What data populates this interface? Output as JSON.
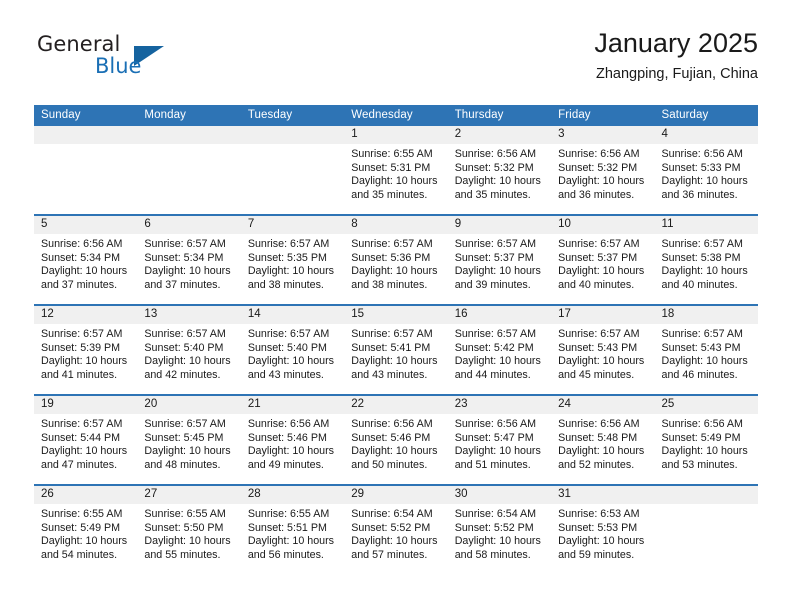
{
  "brand": {
    "name_part1": "General",
    "name_part2": "Blue",
    "triangle_color": "#15639f",
    "blue_text_color": "#1a6fb5"
  },
  "header": {
    "title": "January 2025",
    "subtitle": "Zhangping, Fujian, China"
  },
  "theme": {
    "header_blue": "#2e74b5",
    "daynum_band": "#f0f0f0",
    "text": "#1a1a1a"
  },
  "weekday_headers": [
    "Sunday",
    "Monday",
    "Tuesday",
    "Wednesday",
    "Thursday",
    "Friday",
    "Saturday"
  ],
  "labels": {
    "sunrise_prefix": "Sunrise:",
    "sunset_prefix": "Sunset:",
    "daylight_prefix": "Daylight:"
  },
  "weeks": [
    [
      {
        "day": "",
        "sunrise": "",
        "sunset": "",
        "daylight_line1": "",
        "daylight_line2": ""
      },
      {
        "day": "",
        "sunrise": "",
        "sunset": "",
        "daylight_line1": "",
        "daylight_line2": ""
      },
      {
        "day": "",
        "sunrise": "",
        "sunset": "",
        "daylight_line1": "",
        "daylight_line2": ""
      },
      {
        "day": "1",
        "sunrise": "Sunrise: 6:55 AM",
        "sunset": "Sunset: 5:31 PM",
        "daylight_line1": "Daylight: 10 hours",
        "daylight_line2": "and 35 minutes."
      },
      {
        "day": "2",
        "sunrise": "Sunrise: 6:56 AM",
        "sunset": "Sunset: 5:32 PM",
        "daylight_line1": "Daylight: 10 hours",
        "daylight_line2": "and 35 minutes."
      },
      {
        "day": "3",
        "sunrise": "Sunrise: 6:56 AM",
        "sunset": "Sunset: 5:32 PM",
        "daylight_line1": "Daylight: 10 hours",
        "daylight_line2": "and 36 minutes."
      },
      {
        "day": "4",
        "sunrise": "Sunrise: 6:56 AM",
        "sunset": "Sunset: 5:33 PM",
        "daylight_line1": "Daylight: 10 hours",
        "daylight_line2": "and 36 minutes."
      }
    ],
    [
      {
        "day": "5",
        "sunrise": "Sunrise: 6:56 AM",
        "sunset": "Sunset: 5:34 PM",
        "daylight_line1": "Daylight: 10 hours",
        "daylight_line2": "and 37 minutes."
      },
      {
        "day": "6",
        "sunrise": "Sunrise: 6:57 AM",
        "sunset": "Sunset: 5:34 PM",
        "daylight_line1": "Daylight: 10 hours",
        "daylight_line2": "and 37 minutes."
      },
      {
        "day": "7",
        "sunrise": "Sunrise: 6:57 AM",
        "sunset": "Sunset: 5:35 PM",
        "daylight_line1": "Daylight: 10 hours",
        "daylight_line2": "and 38 minutes."
      },
      {
        "day": "8",
        "sunrise": "Sunrise: 6:57 AM",
        "sunset": "Sunset: 5:36 PM",
        "daylight_line1": "Daylight: 10 hours",
        "daylight_line2": "and 38 minutes."
      },
      {
        "day": "9",
        "sunrise": "Sunrise: 6:57 AM",
        "sunset": "Sunset: 5:37 PM",
        "daylight_line1": "Daylight: 10 hours",
        "daylight_line2": "and 39 minutes."
      },
      {
        "day": "10",
        "sunrise": "Sunrise: 6:57 AM",
        "sunset": "Sunset: 5:37 PM",
        "daylight_line1": "Daylight: 10 hours",
        "daylight_line2": "and 40 minutes."
      },
      {
        "day": "11",
        "sunrise": "Sunrise: 6:57 AM",
        "sunset": "Sunset: 5:38 PM",
        "daylight_line1": "Daylight: 10 hours",
        "daylight_line2": "and 40 minutes."
      }
    ],
    [
      {
        "day": "12",
        "sunrise": "Sunrise: 6:57 AM",
        "sunset": "Sunset: 5:39 PM",
        "daylight_line1": "Daylight: 10 hours",
        "daylight_line2": "and 41 minutes."
      },
      {
        "day": "13",
        "sunrise": "Sunrise: 6:57 AM",
        "sunset": "Sunset: 5:40 PM",
        "daylight_line1": "Daylight: 10 hours",
        "daylight_line2": "and 42 minutes."
      },
      {
        "day": "14",
        "sunrise": "Sunrise: 6:57 AM",
        "sunset": "Sunset: 5:40 PM",
        "daylight_line1": "Daylight: 10 hours",
        "daylight_line2": "and 43 minutes."
      },
      {
        "day": "15",
        "sunrise": "Sunrise: 6:57 AM",
        "sunset": "Sunset: 5:41 PM",
        "daylight_line1": "Daylight: 10 hours",
        "daylight_line2": "and 43 minutes."
      },
      {
        "day": "16",
        "sunrise": "Sunrise: 6:57 AM",
        "sunset": "Sunset: 5:42 PM",
        "daylight_line1": "Daylight: 10 hours",
        "daylight_line2": "and 44 minutes."
      },
      {
        "day": "17",
        "sunrise": "Sunrise: 6:57 AM",
        "sunset": "Sunset: 5:43 PM",
        "daylight_line1": "Daylight: 10 hours",
        "daylight_line2": "and 45 minutes."
      },
      {
        "day": "18",
        "sunrise": "Sunrise: 6:57 AM",
        "sunset": "Sunset: 5:43 PM",
        "daylight_line1": "Daylight: 10 hours",
        "daylight_line2": "and 46 minutes."
      }
    ],
    [
      {
        "day": "19",
        "sunrise": "Sunrise: 6:57 AM",
        "sunset": "Sunset: 5:44 PM",
        "daylight_line1": "Daylight: 10 hours",
        "daylight_line2": "and 47 minutes."
      },
      {
        "day": "20",
        "sunrise": "Sunrise: 6:57 AM",
        "sunset": "Sunset: 5:45 PM",
        "daylight_line1": "Daylight: 10 hours",
        "daylight_line2": "and 48 minutes."
      },
      {
        "day": "21",
        "sunrise": "Sunrise: 6:56 AM",
        "sunset": "Sunset: 5:46 PM",
        "daylight_line1": "Daylight: 10 hours",
        "daylight_line2": "and 49 minutes."
      },
      {
        "day": "22",
        "sunrise": "Sunrise: 6:56 AM",
        "sunset": "Sunset: 5:46 PM",
        "daylight_line1": "Daylight: 10 hours",
        "daylight_line2": "and 50 minutes."
      },
      {
        "day": "23",
        "sunrise": "Sunrise: 6:56 AM",
        "sunset": "Sunset: 5:47 PM",
        "daylight_line1": "Daylight: 10 hours",
        "daylight_line2": "and 51 minutes."
      },
      {
        "day": "24",
        "sunrise": "Sunrise: 6:56 AM",
        "sunset": "Sunset: 5:48 PM",
        "daylight_line1": "Daylight: 10 hours",
        "daylight_line2": "and 52 minutes."
      },
      {
        "day": "25",
        "sunrise": "Sunrise: 6:56 AM",
        "sunset": "Sunset: 5:49 PM",
        "daylight_line1": "Daylight: 10 hours",
        "daylight_line2": "and 53 minutes."
      }
    ],
    [
      {
        "day": "26",
        "sunrise": "Sunrise: 6:55 AM",
        "sunset": "Sunset: 5:49 PM",
        "daylight_line1": "Daylight: 10 hours",
        "daylight_line2": "and 54 minutes."
      },
      {
        "day": "27",
        "sunrise": "Sunrise: 6:55 AM",
        "sunset": "Sunset: 5:50 PM",
        "daylight_line1": "Daylight: 10 hours",
        "daylight_line2": "and 55 minutes."
      },
      {
        "day": "28",
        "sunrise": "Sunrise: 6:55 AM",
        "sunset": "Sunset: 5:51 PM",
        "daylight_line1": "Daylight: 10 hours",
        "daylight_line2": "and 56 minutes."
      },
      {
        "day": "29",
        "sunrise": "Sunrise: 6:54 AM",
        "sunset": "Sunset: 5:52 PM",
        "daylight_line1": "Daylight: 10 hours",
        "daylight_line2": "and 57 minutes."
      },
      {
        "day": "30",
        "sunrise": "Sunrise: 6:54 AM",
        "sunset": "Sunset: 5:52 PM",
        "daylight_line1": "Daylight: 10 hours",
        "daylight_line2": "and 58 minutes."
      },
      {
        "day": "31",
        "sunrise": "Sunrise: 6:53 AM",
        "sunset": "Sunset: 5:53 PM",
        "daylight_line1": "Daylight: 10 hours",
        "daylight_line2": "and 59 minutes."
      },
      {
        "day": "",
        "sunrise": "",
        "sunset": "",
        "daylight_line1": "",
        "daylight_line2": ""
      }
    ]
  ]
}
